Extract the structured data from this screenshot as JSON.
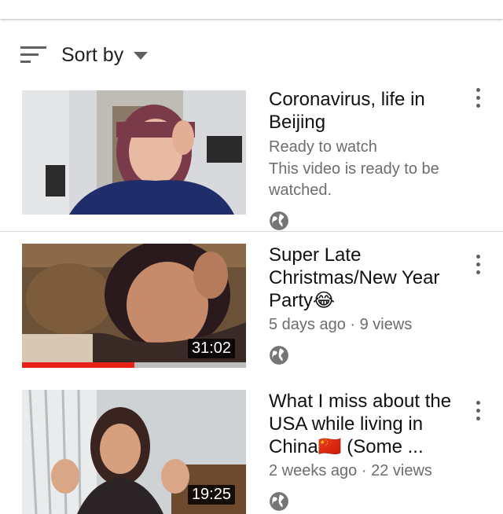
{
  "sort": {
    "label": "Sort by",
    "icon": "sort-icon"
  },
  "colors": {
    "accent": "#e62117",
    "meta_text": "#6d6d6d"
  },
  "videos": [
    {
      "title": "Coronavirus, life in Beijing",
      "status": "Ready to watch",
      "description": "This video is ready to be watched.",
      "duration": "",
      "visibility_icon": "globe-icon"
    },
    {
      "title": "Super Late Christmas/New Year Party😂",
      "meta": "5 days ago · 9 views",
      "duration": "31:02",
      "watch_progress": 0.5,
      "visibility_icon": "globe-icon"
    },
    {
      "title": "What I miss about the USA while living in China🇨🇳 (Some ...",
      "meta": "2 weeks ago · 22 views",
      "duration": "19:25",
      "visibility_icon": "globe-icon"
    }
  ]
}
